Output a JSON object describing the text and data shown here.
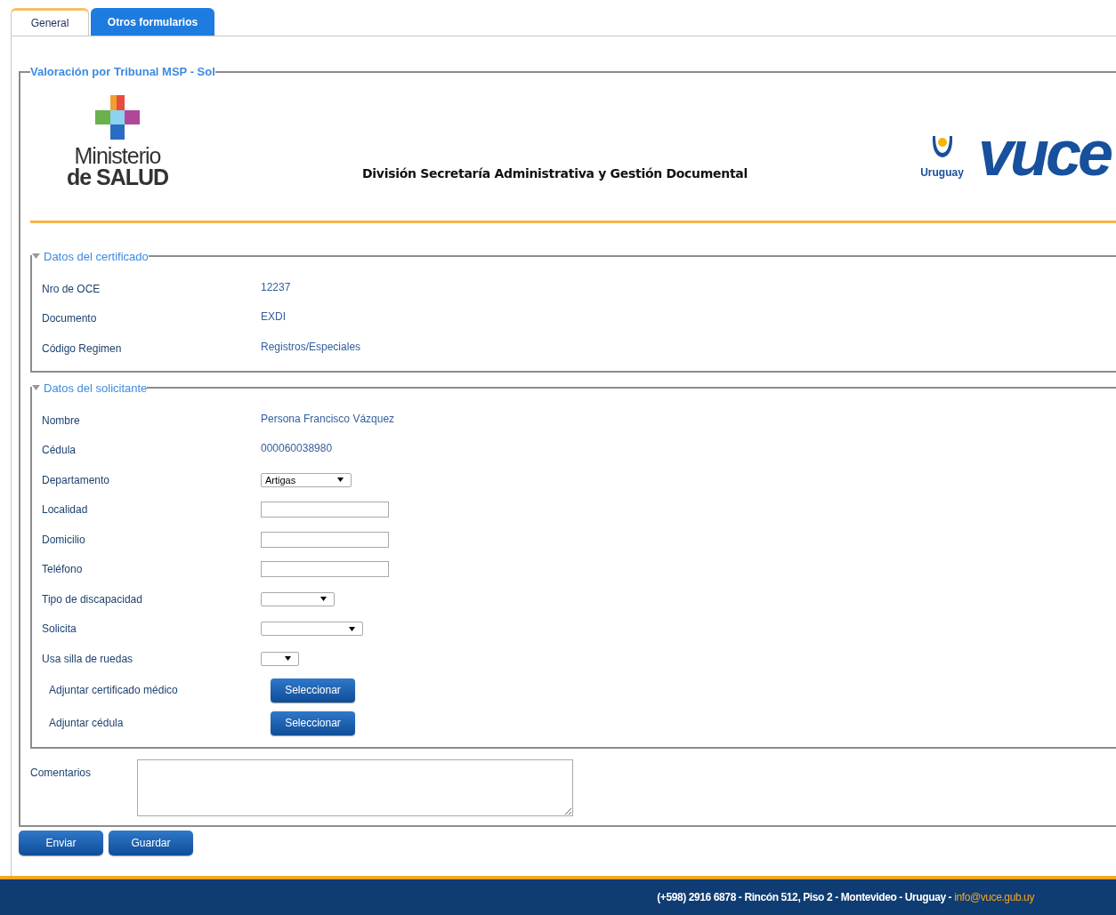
{
  "tabs": [
    {
      "label": "General",
      "selected": true
    },
    {
      "label": "Otros formularios",
      "selected": false
    }
  ],
  "form": {
    "legend": "Valoración por Tribunal MSP - Sol",
    "header": {
      "left_logo": {
        "line1": "Ministerio",
        "line2": "de SALUD"
      },
      "title": "División Secretaría Administrativa y Gestión Documental",
      "right_logo": {
        "country": "Uruguay",
        "brand": "vuce"
      }
    },
    "sections": [
      {
        "legend": "Datos del certificado",
        "expanded": true,
        "fields": [
          {
            "kind": "text",
            "label": "Nro de OCE",
            "value": "12237"
          },
          {
            "kind": "text",
            "label": "Documento",
            "value": "EXDI"
          },
          {
            "kind": "text",
            "label": "Código Regimen",
            "value": "Registros/Especiales"
          }
        ]
      },
      {
        "legend": "Datos del solicitante",
        "expanded": true,
        "fields": [
          {
            "kind": "text",
            "label": "Nombre",
            "value": "Persona Francisco Vázquez"
          },
          {
            "kind": "text",
            "label": "Cédula",
            "value": "000060038980"
          },
          {
            "kind": "select",
            "label": "Departamento",
            "value": "Artigas"
          },
          {
            "kind": "input",
            "label": "Localidad"
          },
          {
            "kind": "input",
            "label": "Domicilio"
          },
          {
            "kind": "input",
            "label": "Teléfono"
          },
          {
            "kind": "select",
            "label": "Tipo de discapacidad"
          },
          {
            "kind": "select",
            "label": "Solicita"
          },
          {
            "kind": "select",
            "label": "Usa silla de ruedas"
          },
          {
            "kind": "file",
            "label": "Adjuntar certificado médico",
            "button": "Seleccionar"
          },
          {
            "kind": "file",
            "label": "Adjuntar cédula",
            "button": "Seleccionar"
          }
        ]
      }
    ],
    "comments": {
      "label": "Comentarios"
    }
  },
  "buttons": [
    "Enviar",
    "Guardar"
  ],
  "footer": {
    "contact": "(+598) 2916 6878 - Rincón 512, Piso 2 - Montevideo - Uruguay - ",
    "email": "info@vuce.gub.uy"
  }
}
